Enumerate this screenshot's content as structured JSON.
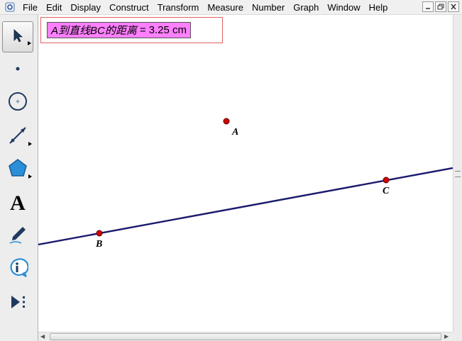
{
  "menubar": {
    "items": [
      "File",
      "Edit",
      "Display",
      "Construct",
      "Transform",
      "Measure",
      "Number",
      "Graph",
      "Window",
      "Help"
    ]
  },
  "toolbox": {
    "tools": [
      {
        "name": "selection-arrow",
        "icon": "arrow-cursor-icon",
        "selected": true
      },
      {
        "name": "point",
        "icon": "point-icon"
      },
      {
        "name": "compass",
        "icon": "compass-circle-icon"
      },
      {
        "name": "straightedge",
        "icon": "segment-icon"
      },
      {
        "name": "polygon",
        "icon": "pentagon-icon"
      },
      {
        "name": "text",
        "icon": "text-icon",
        "glyph": "A"
      },
      {
        "name": "marker",
        "icon": "marker-pen-icon"
      },
      {
        "name": "information",
        "icon": "info-icon"
      },
      {
        "name": "custom",
        "icon": "custom-tool-icon"
      }
    ]
  },
  "canvas": {
    "measurement": {
      "label": "A到直线BC的距离",
      "equals": "=",
      "value": "3.25 cm"
    },
    "points": {
      "A": "A",
      "B": "B",
      "C": "C"
    },
    "colors": {
      "line": "#1a1a6e",
      "point_fill": "#d40000",
      "measurement_bg": "#ff80ff"
    }
  }
}
